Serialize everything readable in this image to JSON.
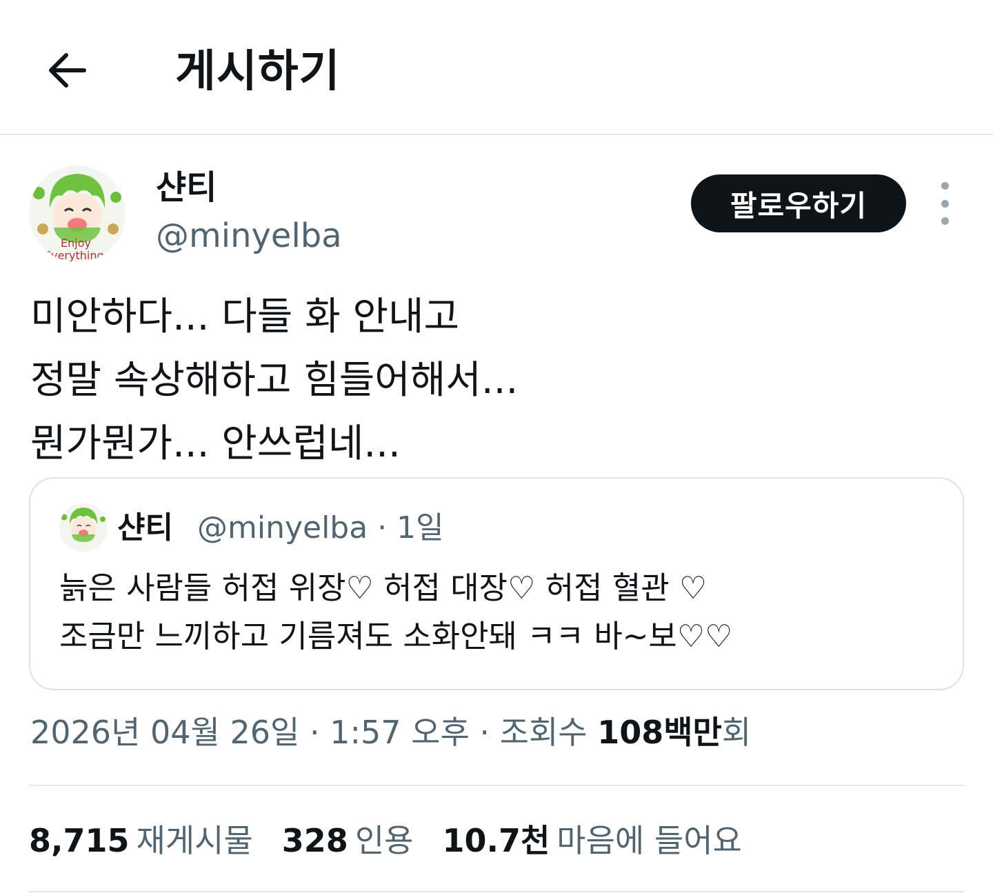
{
  "header": {
    "title": "게시하기",
    "back_icon": "arrow-left-icon"
  },
  "author": {
    "name": "샨티",
    "handle": "@minyelba",
    "avatar_text": [
      "Enjoy",
      "Everything"
    ],
    "follow_label": "팔로우하기",
    "more_icon": "more-vertical-icon"
  },
  "post": {
    "lines": [
      "미안하다... 다들 화 안내고",
      "정말 속상해하고 힘들어해서...",
      "뭔가뭔가... 안쓰럽네..."
    ]
  },
  "quote": {
    "name": "샨티",
    "meta": "@minyelba · 1일",
    "lines": [
      "늙은 사람들 허접 위장♡ 허접 대장♡ 허접 혈관 ♡",
      "조금만 느끼하고 기름져도 소화안돼 ㅋㅋ 바~보♡♡"
    ]
  },
  "timestamp": {
    "date_time": "2026년 04월 26일 · 1:57 오후 · 조회수 ",
    "views_value": "108백만",
    "views_suffix": "회"
  },
  "stats": [
    {
      "value": "8,715",
      "label": "재게시물"
    },
    {
      "value": "328",
      "label": "인용"
    },
    {
      "value": "10.7천",
      "label": "마음에 들어요"
    }
  ],
  "colors": {
    "text": "#0f1419",
    "secondary": "#536471",
    "border": "#e6e9ec",
    "follow_bg": "#0f1419"
  }
}
